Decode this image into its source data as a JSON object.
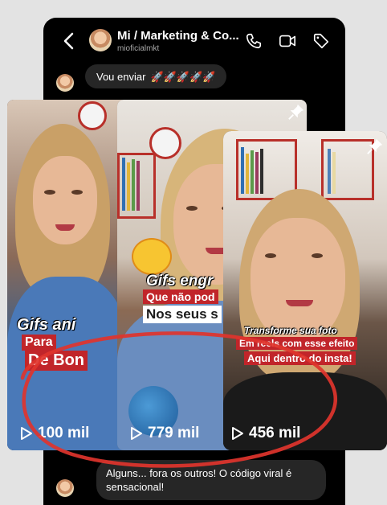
{
  "header": {
    "title": "Mi / Marketing & Co...",
    "subtitle": "mioficialmkt"
  },
  "messages": {
    "first": {
      "text": "Vou enviar",
      "rockets": "🚀🚀🚀🚀🚀"
    },
    "last": {
      "text": "Alguns... fora os outros! O código viral é sensacional!"
    }
  },
  "reels": [
    {
      "views": "100 mil",
      "captions": [
        "Gifs ani",
        "Para",
        "De Bon"
      ]
    },
    {
      "views": "779 mil",
      "captions": [
        "Gifs engr",
        "Que não pod",
        "Nos seus s"
      ]
    },
    {
      "views": "456 mil",
      "captions": [
        "Transforme sua foto",
        "Em reels com esse efeito",
        "Aqui dentro do insta!"
      ]
    }
  ],
  "colors": {
    "accent_red": "#e0342c",
    "bubble": "#262626",
    "background": "#000000"
  },
  "icons": [
    "back-icon",
    "phone-icon",
    "video-icon",
    "tag-icon",
    "play-icon",
    "pin-icon"
  ]
}
